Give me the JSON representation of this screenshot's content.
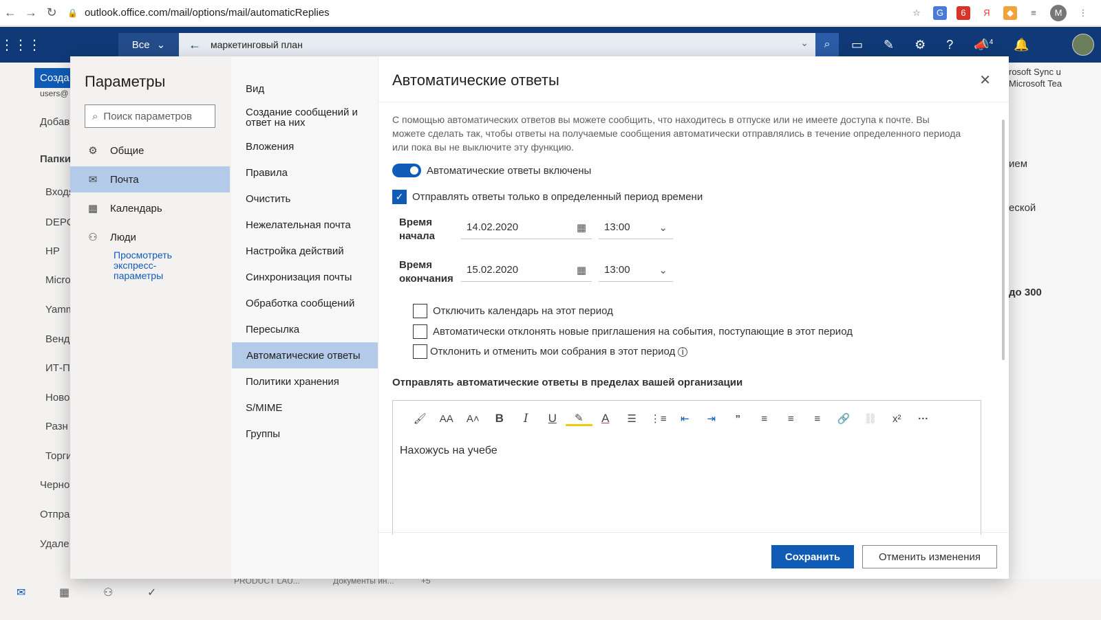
{
  "browser": {
    "url": "outlook.office.com/mail/options/mail/automaticReplies",
    "profile_initial": "M",
    "ext_badge": "6"
  },
  "topbar": {
    "scope_label": "Все",
    "search_value": "маркетинговый план",
    "notif_count": "4"
  },
  "background": {
    "left_items": [
      "Созда",
      "users@",
      "Добав",
      "Папки",
      "Входя",
      "DEPO",
      "HP",
      "Micro",
      "Yamm",
      "Венд",
      "ИТ-П",
      "Ново",
      "Разн",
      "Торги",
      "Черно",
      "Отпра",
      "Удале"
    ],
    "right_items": [
      "rosoft Sync u",
      "Microsoft Tea",
      "ием",
      "еской",
      "до 300"
    ],
    "bottom_items": [
      "PRODUCT LAU...",
      "Документы ин...",
      "+5"
    ]
  },
  "settings": {
    "title": "Параметры",
    "search_placeholder": "Поиск параметров",
    "categories": [
      {
        "label": "Общие",
        "icon": "gear-icon"
      },
      {
        "label": "Почта",
        "icon": "mail-icon"
      },
      {
        "label": "Календарь",
        "icon": "calendar-icon"
      },
      {
        "label": "Люди",
        "icon": "people-icon"
      }
    ],
    "quick_link": "Просмотреть экспресс-параметры"
  },
  "mail_menu": [
    "Вид",
    "Создание сообщений и ответ на них",
    "Вложения",
    "Правила",
    "Очистить",
    "Нежелательная почта",
    "Настройка действий",
    "Синхронизация почты",
    "Обработка сообщений",
    "Пересылка",
    "Автоматические ответы",
    "Политики хранения",
    "S/MIME",
    "Группы"
  ],
  "auto_replies": {
    "title": "Автоматические ответы",
    "intro": "С помощью автоматических ответов вы можете сообщить, что находитесь в отпуске или не имеете доступа к почте. Вы можете сделать так, чтобы ответы на получаемые сообщения автоматически отправлялись в течение определенного периода или пока вы не выключите эту функцию.",
    "toggle_label": "Автоматические ответы включены",
    "period_label": "Отправлять ответы только в определенный период времени",
    "start_label": "Время начала",
    "start_date": "14.02.2020",
    "start_time": "13:00",
    "end_label": "Время окончания",
    "end_date": "15.02.2020",
    "end_time": "13:00",
    "opt_calendar": "Отключить календарь на этот период",
    "opt_decline": "Автоматически отклонять новые приглашения на события, поступающие в этот период",
    "opt_cancel": "Отклонить и отменить мои собрания в этот период",
    "section_title": "Отправлять автоматические ответы в пределах вашей организации",
    "message": "Нахожусь на учебе",
    "save": "Сохранить",
    "discard": "Отменить изменения"
  },
  "toolbar_icons": [
    "format-painter-icon",
    "font-icon",
    "font-size-icon",
    "bold-icon",
    "italic-icon",
    "underline-icon",
    "highlight-icon",
    "font-color-icon",
    "bullets-icon",
    "numbering-icon",
    "outdent-icon",
    "indent-icon",
    "quote-icon",
    "align-left-icon",
    "align-center-icon",
    "align-right-icon",
    "link-icon",
    "unlink-icon",
    "superscript-icon",
    "more-icon"
  ],
  "colors": {
    "brand": "#0f3a77",
    "accent": "#0f5bb5",
    "selected": "#b3cbe8"
  }
}
